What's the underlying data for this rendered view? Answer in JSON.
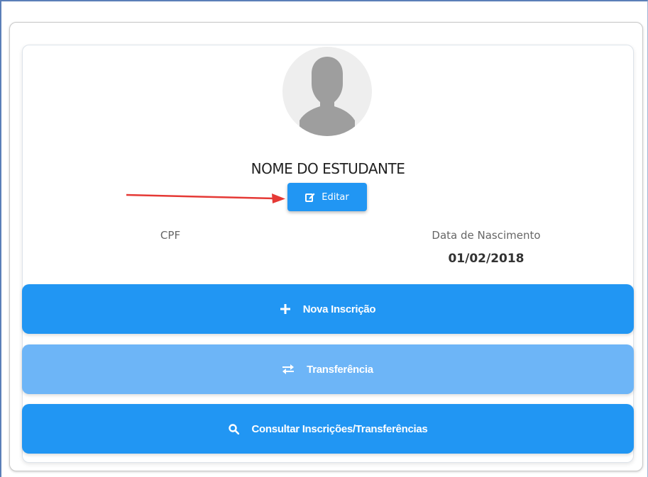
{
  "student": {
    "name": "NOME DO ESTUDANTE",
    "edit_label": "Editar"
  },
  "info": {
    "cpf_label": "CPF",
    "cpf_value": "",
    "dob_label": "Data de Nascimento",
    "dob_value": "01/02/2018"
  },
  "actions": [
    {
      "label": "Nova Inscrição",
      "icon": "plus-icon",
      "enabled": true
    },
    {
      "label": "Transferência",
      "icon": "swap-icon",
      "enabled": false
    },
    {
      "label": "Consultar Inscrições/Transferências",
      "icon": "search-icon",
      "enabled": true
    }
  ],
  "colors": {
    "primary": "#2196f3",
    "primary_light": "#6db5f7",
    "annotation_arrow": "#e53935",
    "avatar_bg": "#eeeeee",
    "avatar_silhouette": "#9e9e9e"
  }
}
